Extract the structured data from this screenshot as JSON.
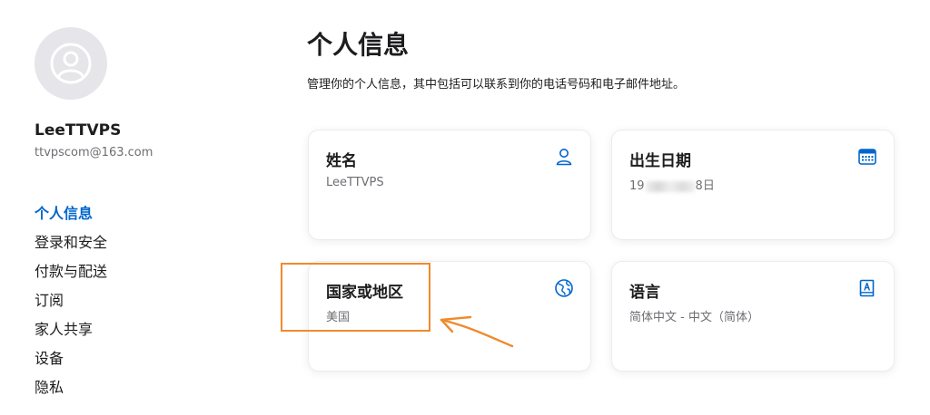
{
  "sidebar": {
    "user_name": "LeeTTVPS",
    "user_email": "ttvpscom@163.com",
    "nav_items": [
      {
        "label": "个人信息",
        "active": true
      },
      {
        "label": "登录和安全",
        "active": false
      },
      {
        "label": "付款与配送",
        "active": false
      },
      {
        "label": "订阅",
        "active": false
      },
      {
        "label": "家人共享",
        "active": false
      },
      {
        "label": "设备",
        "active": false
      },
      {
        "label": "隐私",
        "active": false
      }
    ]
  },
  "main": {
    "title": "个人信息",
    "subtitle": "管理你的个人信息，其中包括可以联系到你的电话号码和电子邮件地址。",
    "cards": {
      "name": {
        "title": "姓名",
        "value": "LeeTTVPS",
        "icon": "person-icon"
      },
      "birthday": {
        "title": "出生日期",
        "value_prefix": "19",
        "value_suffix": "8日",
        "icon": "calendar-icon"
      },
      "country": {
        "title": "国家或地区",
        "value": "美国",
        "icon": "globe-icon"
      },
      "language": {
        "title": "语言",
        "value": "简体中文 - 中文（简体）",
        "icon": "book-icon"
      }
    }
  },
  "colors": {
    "accent": "#0066cc",
    "annotation": "#f08a2c",
    "text_primary": "#1d1d1f",
    "text_secondary": "#6e6e73"
  }
}
